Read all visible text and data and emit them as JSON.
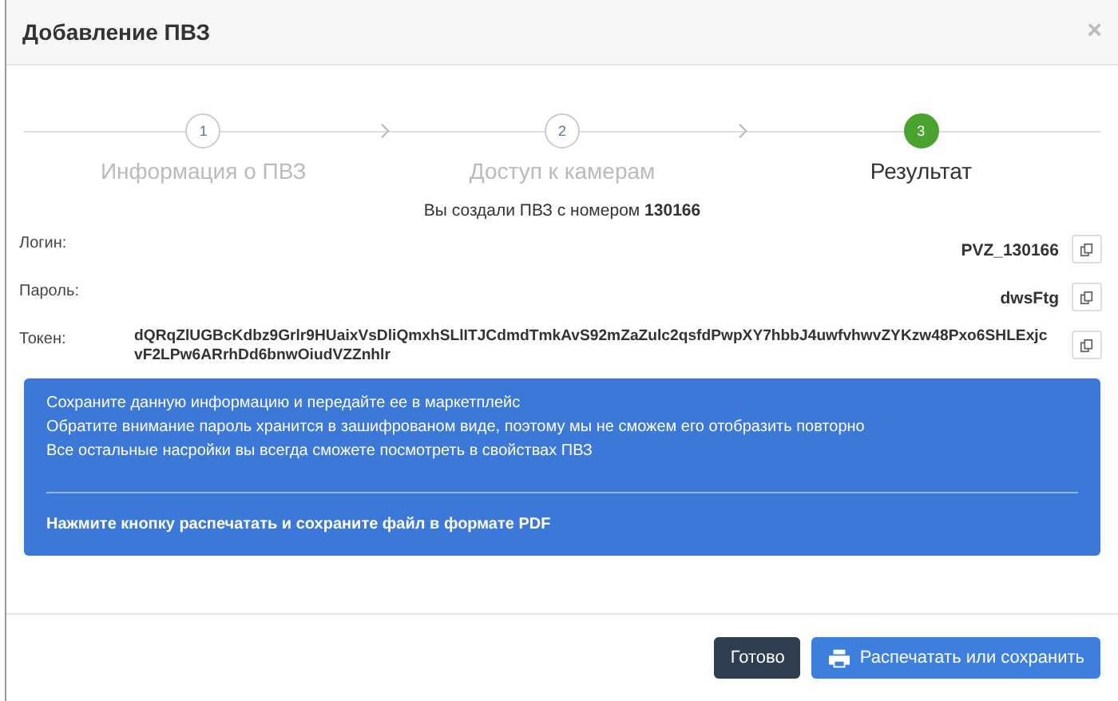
{
  "dialog": {
    "title": "Добавление ПВЗ",
    "close": "×"
  },
  "steps": [
    {
      "number": "1",
      "label": "Информация о ПВЗ",
      "selected": false
    },
    {
      "number": "2",
      "label": "Доступ к камерам",
      "selected": false
    },
    {
      "number": "3",
      "label": "Результат",
      "selected": true
    }
  ],
  "result": {
    "message": "Вы создали ПВЗ с номером **130166**",
    "fields": [
      {
        "label": "Логин:",
        "value": "PVZ_130166"
      },
      {
        "label": "Пароль:",
        "value": "dwsFtg"
      },
      {
        "label": "Токен:",
        "value": "dQRqZlUGBcKdbz9Grlr9HUaixVsDliQmxhSLlITJCdmdTmkAvS92mZaZulc2qsfdPwpXY7hbbJ4uwfvhwvZYKzw48Pxo6SHLExjcvF2LPw6ARrhDd6bnwOiudVZZnhlr"
      }
    ]
  },
  "alert": {
    "lines": [
      "Сохраните данную информацию и передайте ее в маркетплейс",
      "Обратите внимание пароль хранится в зашифрованом виде, поэтому мы не сможем его отобразить повторно",
      "Все остальные насройки вы всегда сможете посмотреть в свойствах ПВЗ"
    ],
    "note": "Нажмите кнопку распечатать и сохраните файл в формате PDF"
  },
  "buttons": [
    {
      "label": "Готово",
      "kind": "dark"
    },
    {
      "label": "Распечатать или сохранить",
      "kind": "print"
    }
  ]
}
